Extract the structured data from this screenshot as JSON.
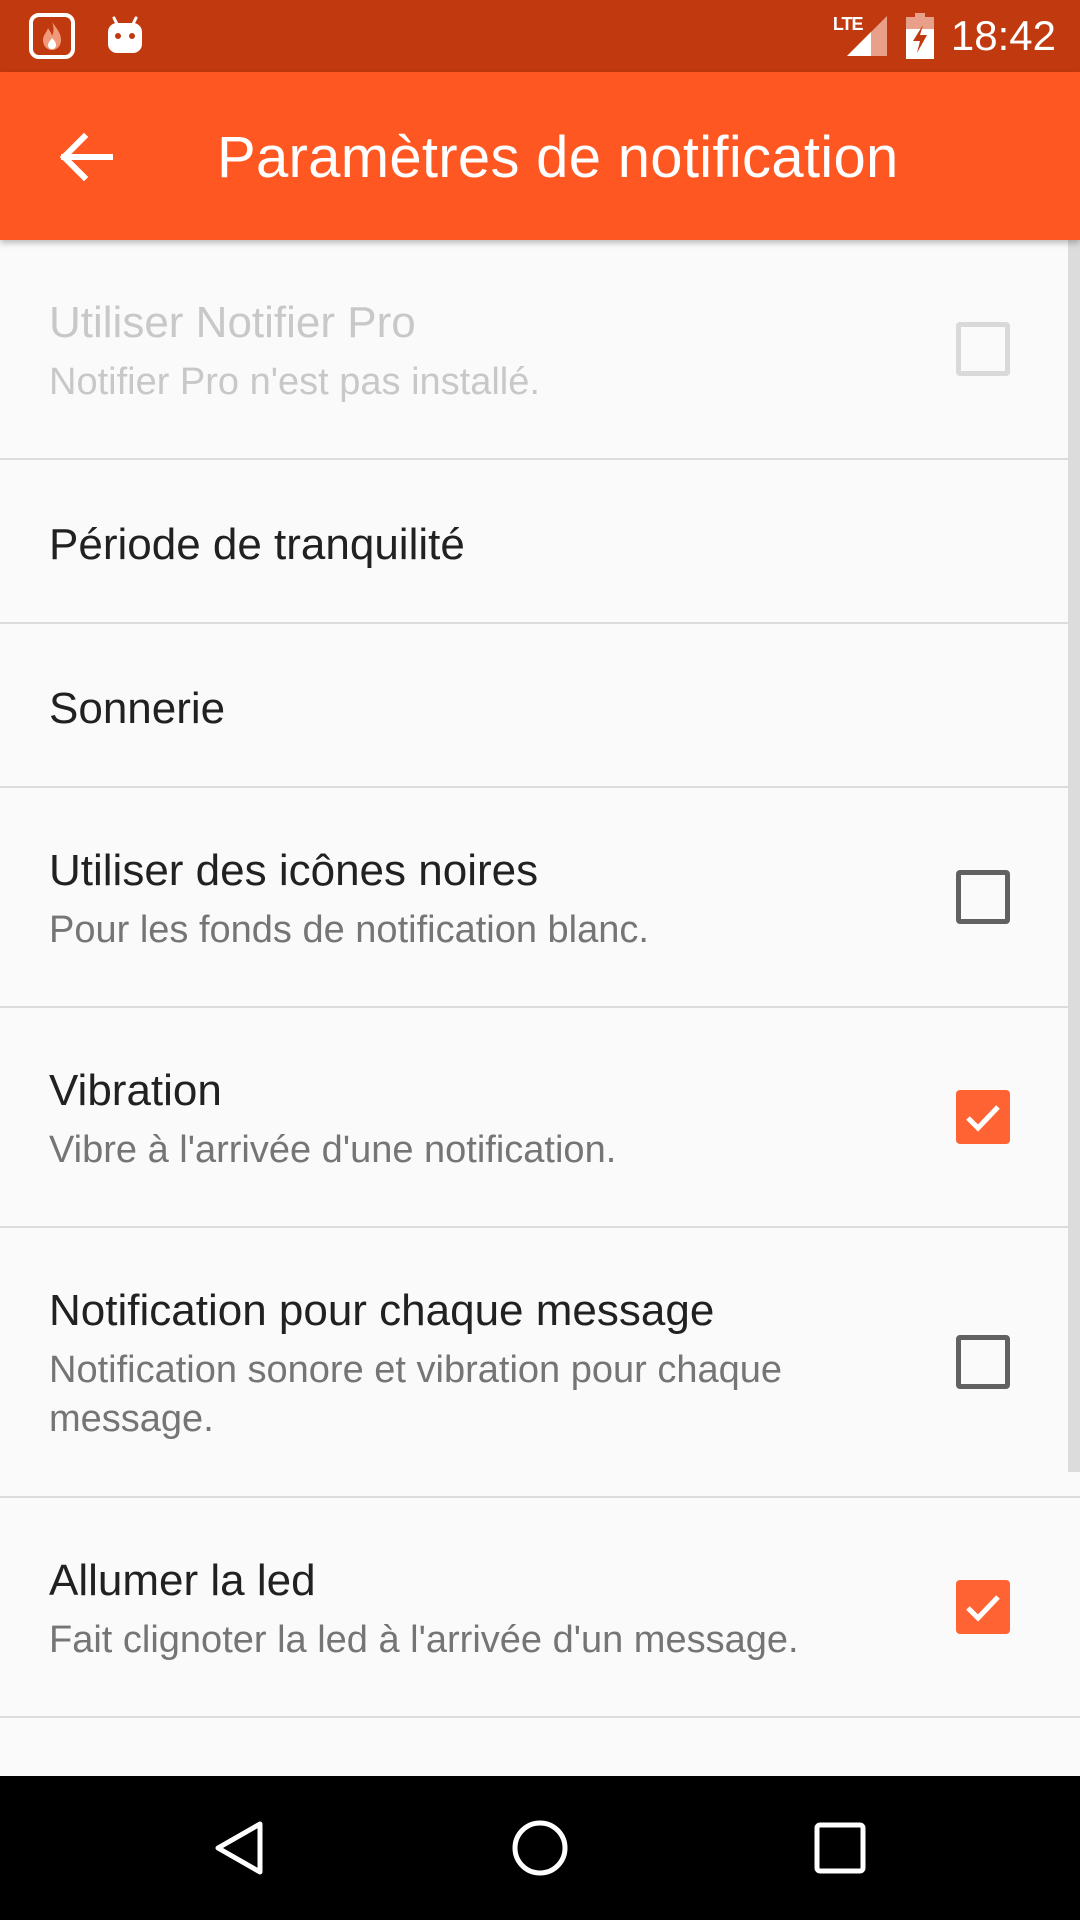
{
  "status_bar": {
    "time": "18:42",
    "network_label": "LTE",
    "icons": [
      "flame-app-icon",
      "android-icon",
      "lte-signal-icon",
      "battery-charging-icon"
    ]
  },
  "app_bar": {
    "title": "Paramètres de notification",
    "back_icon": "arrow-back-icon"
  },
  "preferences": [
    {
      "title": "Utiliser Notifier Pro",
      "summary": "Notifier Pro n'est pas installé.",
      "checkbox": true,
      "checked": false,
      "enabled": false
    },
    {
      "title": "Période de tranquilité",
      "checkbox": false
    },
    {
      "title": "Sonnerie",
      "checkbox": false
    },
    {
      "title": "Utiliser des icônes noires",
      "summary": "Pour les fonds de notification blanc.",
      "checkbox": true,
      "checked": false,
      "enabled": true
    },
    {
      "title": "Vibration",
      "summary": "Vibre à l'arrivée d'une notification.",
      "checkbox": true,
      "checked": true,
      "enabled": true
    },
    {
      "title": "Notification pour chaque message",
      "summary_line1": "Notification sonore et vibration pour chaque",
      "summary_line2": "message.",
      "checkbox": true,
      "checked": false,
      "enabled": true
    },
    {
      "title": "Allumer la led",
      "summary": "Fait clignoter la led à l'arrivée d'un message.",
      "checkbox": true,
      "checked": true,
      "enabled": true
    }
  ],
  "colors": {
    "status_bar": "#c1390e",
    "app_bar": "#ff5722",
    "checkbox_checked": "#ff6333"
  },
  "nav_bar": {
    "icons": [
      "back-triangle-icon",
      "home-circle-icon",
      "recents-square-icon"
    ]
  }
}
